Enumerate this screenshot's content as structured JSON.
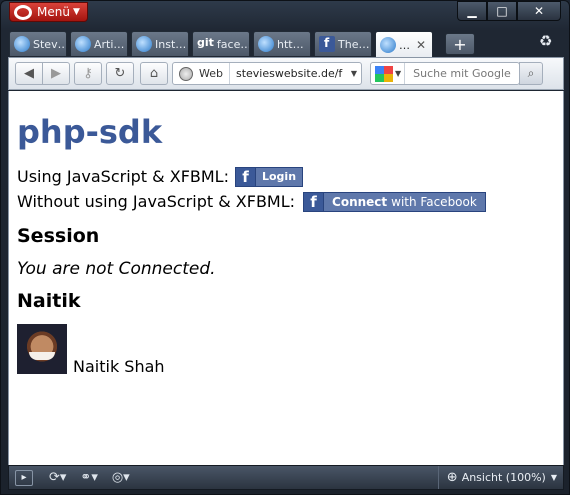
{
  "window": {
    "menu_label": "Menü",
    "controls": {
      "minimize": "▁",
      "maximize": "□",
      "close": "✕"
    }
  },
  "tabs": [
    {
      "label": "Stev…",
      "icon": "opera-site-icon"
    },
    {
      "label": "Arti…",
      "icon": "opera-site-icon"
    },
    {
      "label": "Inst…",
      "icon": "opera-site-icon"
    },
    {
      "label": "face…",
      "icon": "git-icon",
      "icon_text": "git"
    },
    {
      "label": "htt…",
      "icon": "opera-site-icon"
    },
    {
      "label": "The…",
      "icon": "facebook-icon"
    },
    {
      "label": "…",
      "icon": "opera-site-icon",
      "active": true
    }
  ],
  "toolbar": {
    "address_label": "Web",
    "url": "stevieswebsite.de/f",
    "search_placeholder": "Suche mit Google"
  },
  "page": {
    "title": "php-sdk",
    "js_label": "Using JavaScript & XFBML:",
    "login_button": "Login",
    "nojs_label": "Without using JavaScript & XFBML:",
    "connect_button_bold": "Connect",
    "connect_button_rest": "with Facebook",
    "session_heading": "Session",
    "session_status": "You are not Connected.",
    "user_heading": "Naitik",
    "user_name": "Naitik Shah"
  },
  "statusbar": {
    "zoom_label": "Ansicht (100%)"
  },
  "colors": {
    "facebook_blue": "#3b5998",
    "menu_red": "#c8221b"
  }
}
